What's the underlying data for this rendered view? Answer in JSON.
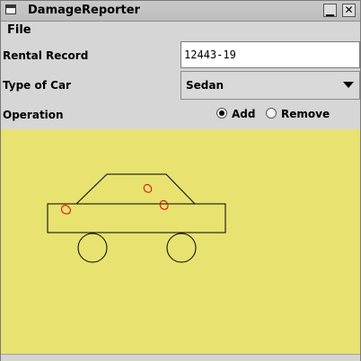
{
  "window": {
    "title": "DamageReporter",
    "minimize_glyph": "▁",
    "close_glyph": "✕"
  },
  "menu": {
    "file_label": "File"
  },
  "form": {
    "rental_record_label": "Rental Record",
    "rental_record_value": "12443-19",
    "car_type_label": "Type of Car",
    "car_type_value": "Sedan",
    "operation_label": "Operation",
    "add_label": "Add",
    "remove_label": "Remove",
    "operation_selected": "Add"
  },
  "canvas": {
    "background_color": "#e8e270",
    "car_outline_color": "#000000",
    "damage_mark_color": "#e00000",
    "icons": [
      "sedan-drawing",
      "damage-mark"
    ],
    "damage_mark_count": 3
  }
}
